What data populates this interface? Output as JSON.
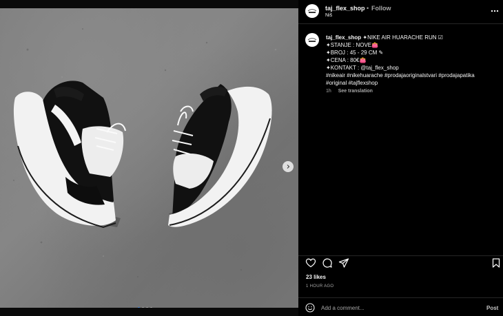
{
  "header": {
    "username": "taj_flex_shop",
    "separator": "•",
    "follow_label": "Follow",
    "location": "Niš"
  },
  "avatar_logo_text": "FLEX SHOP",
  "caption": {
    "username": "taj_flex_shop",
    "line1": " ✦NIKE AIR HUARACHE RUN ☑",
    "line2": "✦STANJE : NOVE👛",
    "line3": "✦BROJ : 45 - 29 CM ✎",
    "line4": "✦CENA : 80€👛",
    "line5": "✦KONTAKT : @taj_flex_shop",
    "line6": "#nikeair #nikehuarache #prodajaoriginalstvari #prodajapatika",
    "line7": "#original #tajflexshop"
  },
  "meta": {
    "age": "1h",
    "translate_label": "See translation"
  },
  "likes": "23 likes",
  "timestamp": "1 HOUR AGO",
  "comment": {
    "placeholder": "Add a comment...",
    "post_label": "Post"
  },
  "carousel": {
    "slide_count": 4,
    "active_index": 0
  },
  "icons": {
    "more": "more-horizontal-icon",
    "like": "heart-icon",
    "comment": "comment-bubble-icon",
    "share": "send-icon",
    "save": "bookmark-icon",
    "emoji": "emoji-smile-icon",
    "next": "chevron-right-icon"
  },
  "colors": {
    "background": "#000000",
    "primary_text": "#f5f5f5",
    "secondary_text": "#a8a8a8",
    "divider": "#262626",
    "carousel_active": "#3e8ef7"
  }
}
